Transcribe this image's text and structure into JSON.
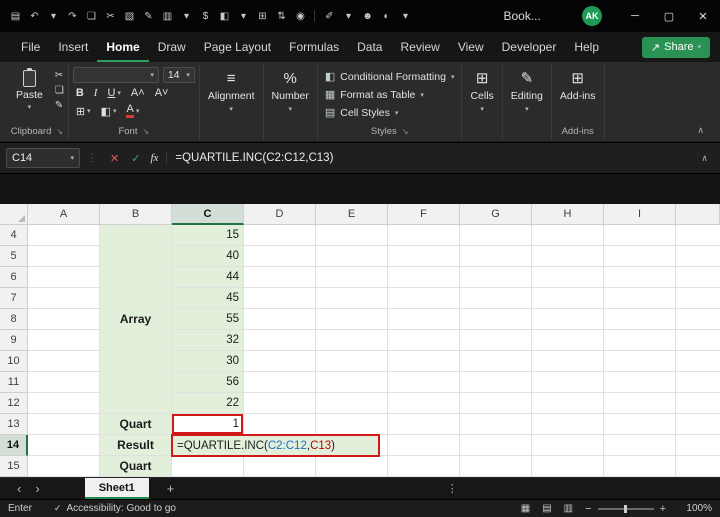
{
  "icons": {
    "chevron_down": "▾",
    "chevron_up": "∧",
    "chevron_left": "‹",
    "chevron_right": "›",
    "minimize": "─",
    "maximize": "▢",
    "close": "✕",
    "check": "✓",
    "dots_vertical": "⋮",
    "plus": "+",
    "minus": "−",
    "launcher": "↘",
    "scissors": "✂",
    "copy_doc": "❏",
    "brush": "✎",
    "borders": "⊞",
    "fill": "◧",
    "font_color_letter": "A",
    "grow_font": "A˄",
    "shrink_font": "A˅",
    "align_lines": "≡",
    "percent": "%",
    "grid_icon": "⊞",
    "pencil": "✎",
    "share_arrow": "↗",
    "view_normal": "▦",
    "view_layout": "▤",
    "view_break": "▥",
    "fx": "fx",
    "cond_format": "◧",
    "format_table": "▦",
    "cell_styles": "▤",
    "addins_grid": "⊞"
  },
  "titlebar": {
    "icons": [
      {
        "name": "save-icon",
        "glyph": "▤"
      },
      {
        "name": "undo-icon",
        "glyph": "↶"
      },
      {
        "name": "undo-chevron-icon",
        "glyph": "▾"
      },
      {
        "name": "redo-icon",
        "glyph": "↷"
      },
      {
        "name": "copy-icon",
        "glyph": "❏"
      },
      {
        "name": "cut-icon",
        "glyph": "✂"
      },
      {
        "name": "paste-icon",
        "glyph": "▧"
      },
      {
        "name": "format-painter-icon",
        "glyph": "✎"
      },
      {
        "name": "printer-icon",
        "glyph": "▥"
      },
      {
        "name": "printer-chevron-icon",
        "glyph": "▾"
      },
      {
        "name": "currency-icon",
        "glyph": "$"
      },
      {
        "name": "fill-color-icon",
        "glyph": "◧"
      },
      {
        "name": "fill-chevron-icon",
        "glyph": "▾"
      },
      {
        "name": "table-icon",
        "glyph": "⊞"
      },
      {
        "name": "sort-icon",
        "glyph": "⇅"
      },
      {
        "name": "camera-icon",
        "glyph": "◉"
      },
      {
        "name": "qat-divider",
        "glyph": "│"
      },
      {
        "name": "draw-icon",
        "glyph": "✐"
      },
      {
        "name": "draw-chevron-icon",
        "glyph": "▾"
      },
      {
        "name": "add-person-icon",
        "glyph": "☻"
      },
      {
        "name": "theme-icon",
        "glyph": "◐"
      },
      {
        "name": "more-commands-icon",
        "glyph": "▾"
      }
    ],
    "doc_title": "Book...",
    "avatar_initials": "AK"
  },
  "menu": {
    "tabs": [
      "File",
      "Insert",
      "Home",
      "Draw",
      "Page Layout",
      "Formulas",
      "Data",
      "Review",
      "View",
      "Developer",
      "Help"
    ],
    "active": "Home",
    "share_label": "Share"
  },
  "ribbon": {
    "paste_label": "Paste",
    "clipboard_label": "Clipboard",
    "font_name_value": "",
    "font_size": "14",
    "bold": "B",
    "italic": "I",
    "underline": "U",
    "font_label": "Font",
    "alignment_label": "Alignment",
    "number_label": "Number",
    "styles": {
      "conditional": "Conditional Formatting",
      "format_table": "Format as Table",
      "cell_styles": "Cell Styles",
      "group_label": "Styles"
    },
    "cells_label": "Cells",
    "editing_label": "Editing",
    "addins_button_label": "Add-ins",
    "addins_group_label": "Add-ins"
  },
  "formula_bar": {
    "name_box": "C14",
    "formula": {
      "prefix": "=QUARTILE.INC(",
      "arg1": "C2:C12",
      "comma": ",",
      "arg2": "C13",
      "suffix": ")"
    }
  },
  "grid": {
    "columns": [
      "A",
      "B",
      "C",
      "D",
      "E",
      "F",
      "G",
      "H",
      "I"
    ],
    "row_numbers": [
      4,
      5,
      6,
      7,
      8,
      9,
      10,
      11,
      12,
      13,
      14,
      15
    ],
    "active_column": "C",
    "active_row": 14,
    "array_label": "Array",
    "array_values": [
      "15",
      "40",
      "44",
      "45",
      "55",
      "32",
      "30",
      "56",
      "22"
    ],
    "quart_label": "Quart",
    "quart_value": "1",
    "result_label": "Result",
    "quart2_label": "Quart"
  },
  "sheet_bar": {
    "sheet_name": "Sheet1"
  },
  "status_bar": {
    "mode": "Enter",
    "accessibility": "Accessibility: Good to go",
    "zoom": "100%"
  }
}
